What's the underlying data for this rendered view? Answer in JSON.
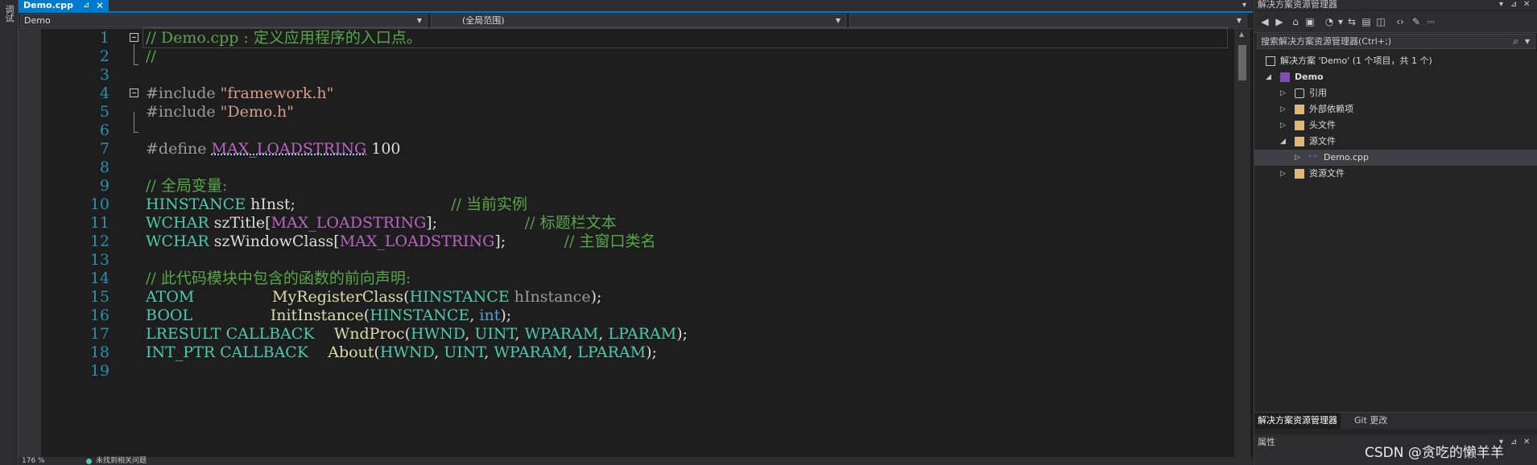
{
  "left_rail": {
    "label": "调试"
  },
  "editor": {
    "tab": {
      "title": "Demo.cpp",
      "pin_icon": "pin-icon",
      "close_glyph": "✕"
    },
    "tab_overflow": "▾",
    "nav": {
      "project": "Demo",
      "scope": "(全局范围)",
      "member": ""
    },
    "lines": [
      {
        "n": "1",
        "segs": [
          {
            "t": "// Demo.cpp : 定义应用程序的入口点。",
            "c": "tcom"
          }
        ]
      },
      {
        "n": "2",
        "segs": [
          {
            "t": "//",
            "c": "tcom"
          }
        ]
      },
      {
        "n": "3",
        "segs": []
      },
      {
        "n": "4",
        "segs": [
          {
            "t": "#include ",
            "c": "tpre"
          },
          {
            "t": "\"framework.h\"",
            "c": "tstr"
          }
        ]
      },
      {
        "n": "5",
        "segs": [
          {
            "t": "#include ",
            "c": "tpre"
          },
          {
            "t": "\"Demo.h\"",
            "c": "tstr"
          }
        ]
      },
      {
        "n": "6",
        "segs": []
      },
      {
        "n": "7",
        "segs": [
          {
            "t": "#define ",
            "c": "tpre"
          },
          {
            "t": "MAX_LOADSTRING",
            "c": "tmac squiggle"
          },
          {
            "t": " 100",
            "c": "tplain"
          }
        ]
      },
      {
        "n": "8",
        "segs": []
      },
      {
        "n": "9",
        "segs": [
          {
            "t": "// 全局变量:",
            "c": "tcom"
          }
        ]
      },
      {
        "n": "10",
        "segs": [
          {
            "t": "HINSTANCE",
            "c": "ttype"
          },
          {
            "t": " hInst;                                ",
            "c": "tplain"
          },
          {
            "t": "// 当前实例",
            "c": "tcom"
          }
        ]
      },
      {
        "n": "11",
        "segs": [
          {
            "t": "WCHAR",
            "c": "ttype"
          },
          {
            "t": " szTitle[",
            "c": "tplain"
          },
          {
            "t": "MAX_LOADSTRING",
            "c": "tmac"
          },
          {
            "t": "];                  ",
            "c": "tplain"
          },
          {
            "t": "// 标题栏文本",
            "c": "tcom"
          }
        ]
      },
      {
        "n": "12",
        "segs": [
          {
            "t": "WCHAR",
            "c": "ttype"
          },
          {
            "t": " szWindowClass[",
            "c": "tplain"
          },
          {
            "t": "MAX_LOADSTRING",
            "c": "tmac"
          },
          {
            "t": "];            ",
            "c": "tplain"
          },
          {
            "t": "// 主窗口类名",
            "c": "tcom"
          }
        ]
      },
      {
        "n": "13",
        "segs": []
      },
      {
        "n": "14",
        "segs": [
          {
            "t": "// 此代码模块中包含的函数的前向声明:",
            "c": "tcom"
          }
        ]
      },
      {
        "n": "15",
        "segs": [
          {
            "t": "ATOM",
            "c": "ttype"
          },
          {
            "t": "                ",
            "c": "tplain"
          },
          {
            "t": "MyRegisterClass",
            "c": "tfunc"
          },
          {
            "t": "(",
            "c": "tplain"
          },
          {
            "t": "HINSTANCE",
            "c": "ttype"
          },
          {
            "t": " hInstance",
            "c": "tpar"
          },
          {
            "t": ");",
            "c": "tplain"
          }
        ]
      },
      {
        "n": "16",
        "segs": [
          {
            "t": "BOOL",
            "c": "ttype"
          },
          {
            "t": "                ",
            "c": "tplain"
          },
          {
            "t": "InitInstance",
            "c": "tfunc"
          },
          {
            "t": "(",
            "c": "tplain"
          },
          {
            "t": "HINSTANCE",
            "c": "ttype"
          },
          {
            "t": ", ",
            "c": "tplain"
          },
          {
            "t": "int",
            "c": "tkw"
          },
          {
            "t": ");",
            "c": "tplain"
          }
        ]
      },
      {
        "n": "17",
        "segs": [
          {
            "t": "LRESULT",
            "c": "ttype"
          },
          {
            "t": " ",
            "c": "tplain"
          },
          {
            "t": "CALLBACK",
            "c": "ttype"
          },
          {
            "t": "    ",
            "c": "tplain"
          },
          {
            "t": "WndProc",
            "c": "tfunc"
          },
          {
            "t": "(",
            "c": "tplain"
          },
          {
            "t": "HWND",
            "c": "ttype"
          },
          {
            "t": ", ",
            "c": "tplain"
          },
          {
            "t": "UINT",
            "c": "ttype"
          },
          {
            "t": ", ",
            "c": "tplain"
          },
          {
            "t": "WPARAM",
            "c": "ttype"
          },
          {
            "t": ", ",
            "c": "tplain"
          },
          {
            "t": "LPARAM",
            "c": "ttype"
          },
          {
            "t": ");",
            "c": "tplain"
          }
        ]
      },
      {
        "n": "18",
        "segs": [
          {
            "t": "INT_PTR",
            "c": "ttype"
          },
          {
            "t": " ",
            "c": "tplain"
          },
          {
            "t": "CALLBACK",
            "c": "ttype"
          },
          {
            "t": "    ",
            "c": "tplain"
          },
          {
            "t": "About",
            "c": "tfunc"
          },
          {
            "t": "(",
            "c": "tplain"
          },
          {
            "t": "HWND",
            "c": "ttype"
          },
          {
            "t": ", ",
            "c": "tplain"
          },
          {
            "t": "UINT",
            "c": "ttype"
          },
          {
            "t": ", ",
            "c": "tplain"
          },
          {
            "t": "WPARAM",
            "c": "ttype"
          },
          {
            "t": ", ",
            "c": "tplain"
          },
          {
            "t": "LPARAM",
            "c": "ttype"
          },
          {
            "t": ");",
            "c": "tplain"
          }
        ]
      },
      {
        "n": "19",
        "segs": []
      }
    ],
    "status": {
      "zoom": "176 %",
      "issues": "未找到相关问题"
    }
  },
  "solution_explorer": {
    "title": "解决方案资源管理器",
    "search_placeholder": "搜索解决方案资源管理器(Ctrl+;)",
    "solution_label": "解决方案 'Demo' (1 个项目，共 1 个)",
    "project_label": "Demo",
    "items": [
      {
        "label": "引用",
        "icon": "reference-icon"
      },
      {
        "label": "外部依赖项",
        "icon": "folder-icon"
      },
      {
        "label": "头文件",
        "icon": "folder-icon"
      },
      {
        "label": "源文件",
        "icon": "folder-icon"
      },
      {
        "label": "Demo.cpp",
        "icon": "cpp-file-icon"
      },
      {
        "label": "资源文件",
        "icon": "folder-icon"
      }
    ],
    "bottom_tabs": [
      "解决方案资源管理器",
      "Git 更改"
    ],
    "properties_title": "属性"
  },
  "watermark": "CSDN @贪吃的懒羊羊",
  "colors": {
    "accent": "#007acc",
    "comment": "#57a64a",
    "string": "#d69d85",
    "macro": "#bd63c5",
    "type": "#4ec9b0",
    "function": "#dcdcaa",
    "keyword": "#569cd6",
    "line_number": "#2b91af"
  }
}
